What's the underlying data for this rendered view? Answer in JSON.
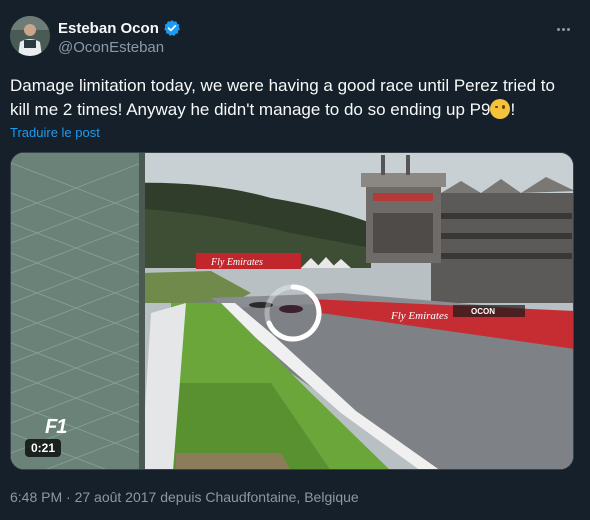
{
  "author": {
    "name": "Esteban Ocon",
    "handle": "@OconEsteban",
    "verified_icon": "verified-badge-icon",
    "accent_color": "#1d9bf0"
  },
  "tweet": {
    "text": "Damage limitation today, we were having a good race until Perez tried to kill me 2 times! Anyway he didn't manage to do so ending up P9",
    "text_end": "!",
    "emoji": "winking-face-emoji",
    "translate_label": "Traduire le post"
  },
  "media": {
    "duration": "0:21",
    "banner_text": "Fly Emirates",
    "wall_text": "Fly Emirates",
    "car_label": "OCON",
    "logo_text": "F1"
  },
  "footer": {
    "timestamp": "6:48 PM · 27 août 2017 depuis Chaudfontaine, Belgique"
  },
  "theme": {
    "background": "#15202b",
    "text_primary": "#f7f9f9",
    "text_secondary": "#8b98a5",
    "link": "#1d9bf0"
  }
}
